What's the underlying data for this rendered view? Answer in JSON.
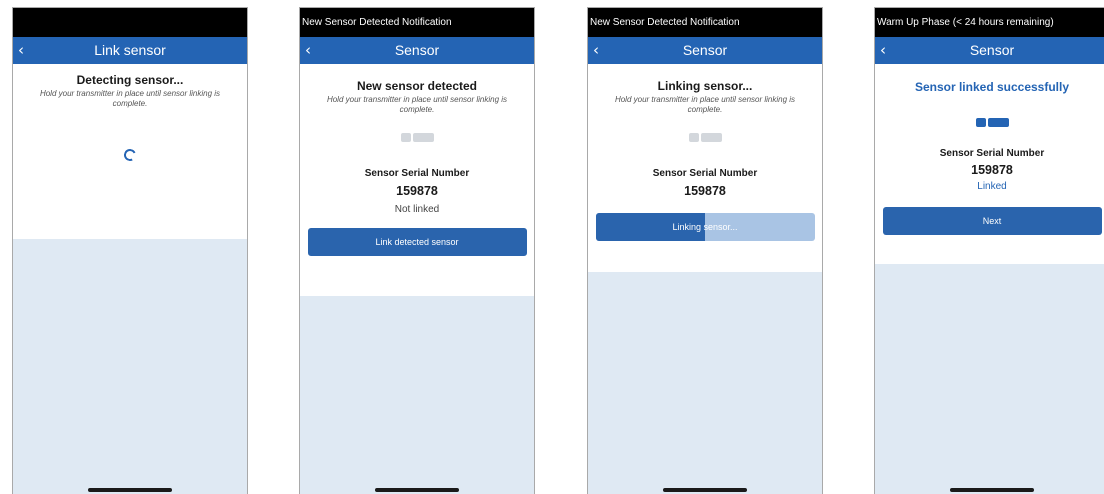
{
  "screen1": {
    "status_bar": "",
    "title": "Link sensor",
    "heading": "Detecting sensor...",
    "instruction": "Hold your transmitter in place until sensor linking is complete."
  },
  "screen2": {
    "status_bar": "New Sensor Detected Notification",
    "title": "Sensor",
    "heading": "New sensor detected",
    "instruction": "Hold your transmitter in place until sensor linking is complete.",
    "serial_label": "Sensor Serial Number",
    "serial": "159878",
    "link_status": "Not linked",
    "button": "Link detected sensor"
  },
  "screen3": {
    "status_bar": "New Sensor Detected Notification",
    "title": "Sensor",
    "heading": "Linking sensor...",
    "instruction": "Hold your transmitter in place until sensor linking is complete.",
    "serial_label": "Sensor Serial Number",
    "serial": "159878",
    "progress_label": "Linking sensor...",
    "progress": 0.5
  },
  "screen4": {
    "status_bar": "Warm Up Phase (< 24 hours remaining)",
    "title": "Sensor",
    "heading": "Sensor linked successfully",
    "serial_label": "Sensor Serial Number",
    "serial": "159878",
    "link_status": "Linked",
    "button": "Next"
  },
  "icons": {
    "back": "chevron-left-icon",
    "spinner": "loading-spinner-icon",
    "sensor": "sensor-icon"
  },
  "colors": {
    "header": "#2464b4",
    "button": "#2a64ad",
    "progress_track": "#a9c4e4",
    "background": "#dfe9f3"
  }
}
